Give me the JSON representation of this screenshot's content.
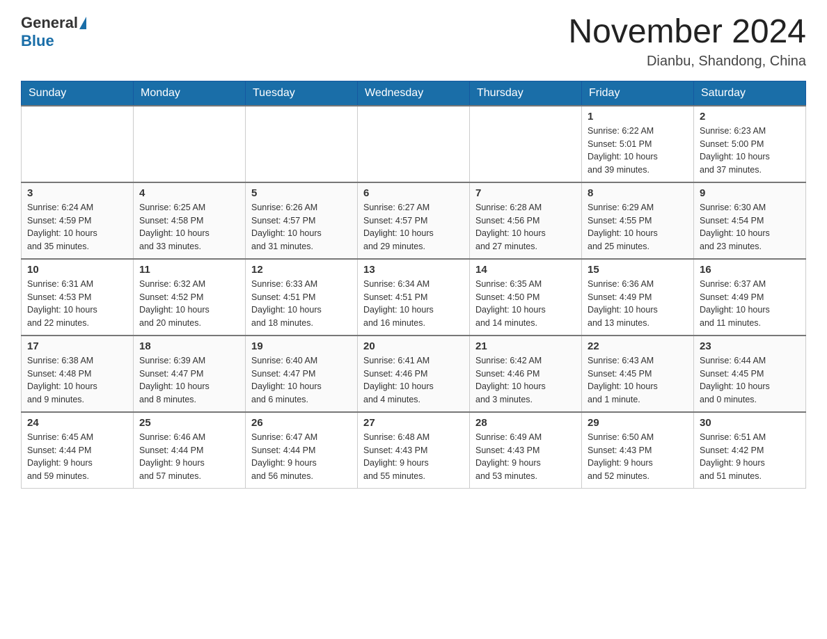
{
  "header": {
    "logo_general": "General",
    "logo_blue": "Blue",
    "month_year": "November 2024",
    "location": "Dianbu, Shandong, China"
  },
  "days_of_week": [
    "Sunday",
    "Monday",
    "Tuesday",
    "Wednesday",
    "Thursday",
    "Friday",
    "Saturday"
  ],
  "weeks": [
    [
      {
        "day": "",
        "info": ""
      },
      {
        "day": "",
        "info": ""
      },
      {
        "day": "",
        "info": ""
      },
      {
        "day": "",
        "info": ""
      },
      {
        "day": "",
        "info": ""
      },
      {
        "day": "1",
        "info": "Sunrise: 6:22 AM\nSunset: 5:01 PM\nDaylight: 10 hours\nand 39 minutes."
      },
      {
        "day": "2",
        "info": "Sunrise: 6:23 AM\nSunset: 5:00 PM\nDaylight: 10 hours\nand 37 minutes."
      }
    ],
    [
      {
        "day": "3",
        "info": "Sunrise: 6:24 AM\nSunset: 4:59 PM\nDaylight: 10 hours\nand 35 minutes."
      },
      {
        "day": "4",
        "info": "Sunrise: 6:25 AM\nSunset: 4:58 PM\nDaylight: 10 hours\nand 33 minutes."
      },
      {
        "day": "5",
        "info": "Sunrise: 6:26 AM\nSunset: 4:57 PM\nDaylight: 10 hours\nand 31 minutes."
      },
      {
        "day": "6",
        "info": "Sunrise: 6:27 AM\nSunset: 4:57 PM\nDaylight: 10 hours\nand 29 minutes."
      },
      {
        "day": "7",
        "info": "Sunrise: 6:28 AM\nSunset: 4:56 PM\nDaylight: 10 hours\nand 27 minutes."
      },
      {
        "day": "8",
        "info": "Sunrise: 6:29 AM\nSunset: 4:55 PM\nDaylight: 10 hours\nand 25 minutes."
      },
      {
        "day": "9",
        "info": "Sunrise: 6:30 AM\nSunset: 4:54 PM\nDaylight: 10 hours\nand 23 minutes."
      }
    ],
    [
      {
        "day": "10",
        "info": "Sunrise: 6:31 AM\nSunset: 4:53 PM\nDaylight: 10 hours\nand 22 minutes."
      },
      {
        "day": "11",
        "info": "Sunrise: 6:32 AM\nSunset: 4:52 PM\nDaylight: 10 hours\nand 20 minutes."
      },
      {
        "day": "12",
        "info": "Sunrise: 6:33 AM\nSunset: 4:51 PM\nDaylight: 10 hours\nand 18 minutes."
      },
      {
        "day": "13",
        "info": "Sunrise: 6:34 AM\nSunset: 4:51 PM\nDaylight: 10 hours\nand 16 minutes."
      },
      {
        "day": "14",
        "info": "Sunrise: 6:35 AM\nSunset: 4:50 PM\nDaylight: 10 hours\nand 14 minutes."
      },
      {
        "day": "15",
        "info": "Sunrise: 6:36 AM\nSunset: 4:49 PM\nDaylight: 10 hours\nand 13 minutes."
      },
      {
        "day": "16",
        "info": "Sunrise: 6:37 AM\nSunset: 4:49 PM\nDaylight: 10 hours\nand 11 minutes."
      }
    ],
    [
      {
        "day": "17",
        "info": "Sunrise: 6:38 AM\nSunset: 4:48 PM\nDaylight: 10 hours\nand 9 minutes."
      },
      {
        "day": "18",
        "info": "Sunrise: 6:39 AM\nSunset: 4:47 PM\nDaylight: 10 hours\nand 8 minutes."
      },
      {
        "day": "19",
        "info": "Sunrise: 6:40 AM\nSunset: 4:47 PM\nDaylight: 10 hours\nand 6 minutes."
      },
      {
        "day": "20",
        "info": "Sunrise: 6:41 AM\nSunset: 4:46 PM\nDaylight: 10 hours\nand 4 minutes."
      },
      {
        "day": "21",
        "info": "Sunrise: 6:42 AM\nSunset: 4:46 PM\nDaylight: 10 hours\nand 3 minutes."
      },
      {
        "day": "22",
        "info": "Sunrise: 6:43 AM\nSunset: 4:45 PM\nDaylight: 10 hours\nand 1 minute."
      },
      {
        "day": "23",
        "info": "Sunrise: 6:44 AM\nSunset: 4:45 PM\nDaylight: 10 hours\nand 0 minutes."
      }
    ],
    [
      {
        "day": "24",
        "info": "Sunrise: 6:45 AM\nSunset: 4:44 PM\nDaylight: 9 hours\nand 59 minutes."
      },
      {
        "day": "25",
        "info": "Sunrise: 6:46 AM\nSunset: 4:44 PM\nDaylight: 9 hours\nand 57 minutes."
      },
      {
        "day": "26",
        "info": "Sunrise: 6:47 AM\nSunset: 4:44 PM\nDaylight: 9 hours\nand 56 minutes."
      },
      {
        "day": "27",
        "info": "Sunrise: 6:48 AM\nSunset: 4:43 PM\nDaylight: 9 hours\nand 55 minutes."
      },
      {
        "day": "28",
        "info": "Sunrise: 6:49 AM\nSunset: 4:43 PM\nDaylight: 9 hours\nand 53 minutes."
      },
      {
        "day": "29",
        "info": "Sunrise: 6:50 AM\nSunset: 4:43 PM\nDaylight: 9 hours\nand 52 minutes."
      },
      {
        "day": "30",
        "info": "Sunrise: 6:51 AM\nSunset: 4:42 PM\nDaylight: 9 hours\nand 51 minutes."
      }
    ]
  ]
}
